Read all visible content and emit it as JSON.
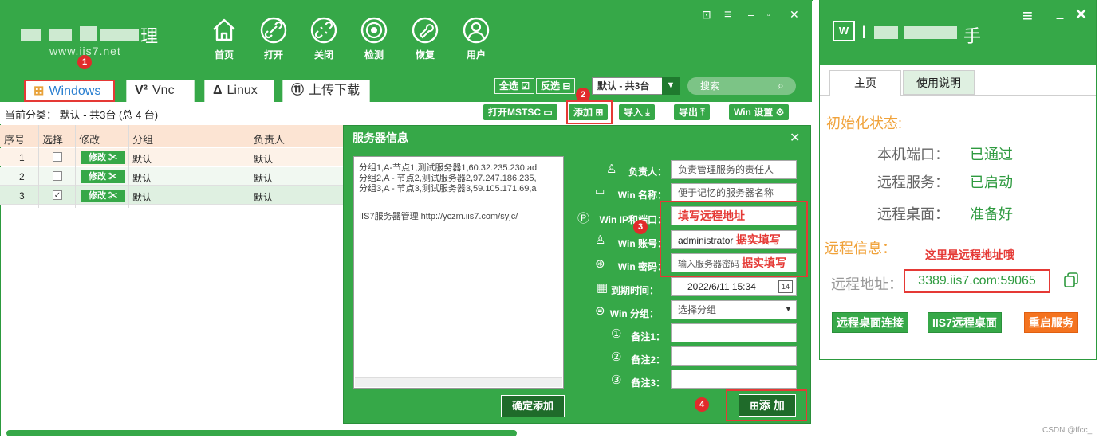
{
  "main": {
    "logo_char": "理",
    "logo_url": "www.iis7.net",
    "nav": [
      {
        "label": "首页",
        "icon": "home-icon"
      },
      {
        "label": "打开",
        "icon": "link-icon"
      },
      {
        "label": "关闭",
        "icon": "unlink-icon"
      },
      {
        "label": "检测",
        "icon": "target-icon"
      },
      {
        "label": "恢复",
        "icon": "wrench-icon"
      },
      {
        "label": "用户",
        "icon": "user-icon"
      }
    ],
    "tabs": [
      {
        "label": "Windows",
        "icon": "windows-icon"
      },
      {
        "label": "Vnc",
        "icon": "vnc-icon"
      },
      {
        "label": "Linux",
        "icon": "linux-icon"
      },
      {
        "label": "上传下载",
        "icon": "upload-icon"
      }
    ],
    "select_all": "全选",
    "invert_select": "反选",
    "group_select": "默认 - 共3台",
    "search_placeholder": "搜索",
    "category_label": "当前分类：  默认 - 共3台 (总 4 台)",
    "toolbar": {
      "open_mstsc": "打开MSTSC",
      "add": "添加",
      "import": "导入",
      "export": "导出",
      "win_settings": "Win 设置"
    },
    "table": {
      "headers": [
        "序号",
        "选择",
        "修改",
        "分组",
        "负责人"
      ],
      "edit_label": "修改",
      "rows": [
        {
          "num": "1",
          "checked": "",
          "group": "默认",
          "owner": "默认"
        },
        {
          "num": "2",
          "checked": "",
          "group": "默认",
          "owner": "默认"
        },
        {
          "num": "3",
          "checked": "✓",
          "group": "默认",
          "owner": "默认"
        }
      ]
    },
    "badges": [
      "1",
      "2",
      "3",
      "4"
    ]
  },
  "dialog": {
    "title": "服务器信息",
    "import_lines": [
      "分组1,A-节点1,测试服务器1,60.32.235.230,ad",
      "分组2,A - 节点2,测试服务器2,97.247.186.235,",
      "分组3,A - 节点3,测试服务器3,59.105.171.69,a"
    ],
    "import_note": "IIS7服务器管理 http://yczm.iis7.com/syjc/",
    "confirm_add": "确定添加",
    "add_button": "添 加",
    "fields": {
      "owner_label": "负责人：",
      "owner_placeholder": "负责管理服务的责任人",
      "name_label": "Win 名称：",
      "name_placeholder": "便于记忆的服务器名称",
      "ip_label": "Win IP和端口：",
      "ip_hint": "填写远程地址",
      "account_label": "Win 账号：",
      "account_value": "administrator",
      "account_hint": "据实填写",
      "password_label": "Win 密码：",
      "password_placeholder": "输入服务器密码",
      "password_hint": "据实填写",
      "expire_label": "到期时间：",
      "expire_value": "2022/6/11 15:34",
      "group_label": "Win 分组：",
      "group_value": "选择分组",
      "note1_label": "备注1：",
      "note2_label": "备注2：",
      "note3_label": "备注3："
    }
  },
  "right": {
    "tabs": [
      "主页",
      "使用说明"
    ],
    "init_heading": "初始化状态:",
    "status": [
      {
        "label": "本机端口：",
        "value": "已通过"
      },
      {
        "label": "远程服务：",
        "value": "已启动"
      },
      {
        "label": "远程桌面：",
        "value": "准备好"
      }
    ],
    "remote_heading": "远程信息：",
    "remote_hint": "这里是远程地址哦",
    "remote_label": "远程地址：",
    "remote_address": "3389.iis7.com:59065",
    "buttons": {
      "connect": "远程桌面连接",
      "iis7": "IIS7远程桌面",
      "restart": "重启服务"
    }
  },
  "watermark": "CSDN @ffcc_",
  "colors": {
    "brand_green": "#36a848",
    "dark_green": "#1f6b2a",
    "highlight_red": "#e53935",
    "orange": "#f0a23a",
    "restart_orange": "#f4731f"
  }
}
